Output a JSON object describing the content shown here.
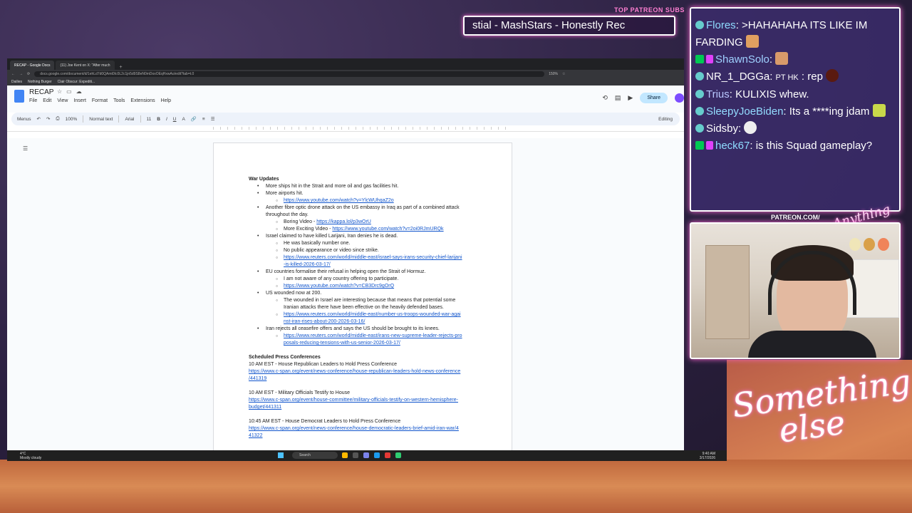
{
  "overlay": {
    "patreon_subs_label": "TOP PATREON SUBS",
    "ticker_text": "stial - MashStars - Honestly Rec",
    "patreon_url": "PATREON.COM/",
    "brand_small": "Anything Else",
    "brand_large_line1": "Something",
    "brand_large_line2": "else"
  },
  "browser": {
    "tabs": [
      {
        "label": "RECAP - Google Docs",
        "active": true
      },
      {
        "label": "(11) Joe Kent on X: \"After much",
        "active": false
      }
    ],
    "new_tab": "+",
    "url": "docs.google.com/document/d/1ehLd7d0QAmt0Ic0L2c1jn5d9S8eN0mDoxOEqHxwAo/edit?tab=t.0",
    "zoom_badge": "150%",
    "bookmarks": [
      "Dailies",
      "Nothing Burger",
      "Clair Obscur: Expediti..."
    ]
  },
  "docs": {
    "title": "RECAP",
    "menu": [
      "File",
      "Edit",
      "View",
      "Insert",
      "Format",
      "Tools",
      "Extensions",
      "Help"
    ],
    "share_label": "Share",
    "toolbar": {
      "menus": "Menus",
      "zoom": "100%",
      "style": "Normal text",
      "font": "Arial",
      "size": "11",
      "editing": "Editing"
    }
  },
  "document": {
    "heading1": "War Updates",
    "b1_ships": "More ships hit in the Strait and more oil and gas facilities hit.",
    "b1_airports": "More airports hit.",
    "l_airports": "https://www.youtube.com/watch?v=YlcWUhqaZ2o",
    "b1_drone1": "Another fibre optic drone attack on the US embassy in Iraq as part of a combined attack",
    "b1_drone2": "throughout the day.",
    "b2_boring_label": "Boring Video - ",
    "l_boring": "https://kappa.lol/p3wOrU",
    "b2_exciting_label": "More Exciting Video - ",
    "l_exciting": "https://www.youtube.com/watch?v=2oi0RJmURQk",
    "b1_larijani": "Israel claimed to have killed Larijani, Iran denies he is dead.",
    "b2_number1": "He was basically number one.",
    "b2_noappear": "No public appearance or video since strike.",
    "l_larijani1": "https://www.reuters.com/world/middle-east/israel-says-irans-security-chief-larijani",
    "l_larijani2": "-is-killed-2026-03-17/",
    "b1_eu": "EU countries formalise their refusal in helping open the Strait of Hormuz.",
    "b2_unaware": "I am not aware of any country offering to participate.",
    "l_eu": "https://www.youtube.com/watch?v=CB3Drc9gOrQ",
    "b1_wounded": "US wounded now at 200.",
    "b2_wounded1": "The wounded in Israel are interesting because that means that potential some",
    "b2_wounded2": "Iranian attacks there have been effective on the heavily defended bases.",
    "l_wounded1": "https://www.reuters.com/world/middle-east/number-us-troops-wounded-war-agai",
    "l_wounded2": "nst-iran-rises-about-200-2026-03-16/",
    "b1_ceasefire": "Iran rejects all ceasefire offers and says the US should be brought to its knees.",
    "l_ceasefire1": "https://www.reuters.com/world/middle-east/irans-new-supreme-leader-rejects-pro",
    "l_ceasefire2": "posals-reducing-tensions-with-us-senior-2026-03-17/",
    "heading2": "Scheduled Press Conferences",
    "pc1": "10 AM EST - House Republican Leaders to Hold Press Conference",
    "pc1_l1": "https://www.c-span.org/event/news-conference/house-republican-leaders-hold-news-conference",
    "pc1_l2": "/441319",
    "pc2": "10 AM EST - Military Officials Testify to House",
    "pc2_l1": "https://www.c-span.org/event/house-committee/military-officials-testify-on-western-hemisphere-",
    "pc2_l2": "budget/441311",
    "pc3": "10:45 AM EST - House Democrat Leaders to Hold Press Conference",
    "pc3_l1": "https://www.c-span.org/event/news-conference/house-democratic-leaders-brief-amid-iran-war/4",
    "pc3_l2": "41322"
  },
  "taskbar": {
    "weather_temp": "4°C",
    "weather_desc": "Mostly cloudy",
    "search": "Search",
    "time": "9:40 AM",
    "date": "3/17/2026"
  },
  "chat": {
    "messages": [
      {
        "user": "Flores",
        "text": ">HAHAHAHA ITS LIKE IM FARDING"
      },
      {
        "user": "ShawnSolo",
        "text": ""
      },
      {
        "user": "NR_1_DGGa",
        "text": "rep",
        "tag": "PT HK"
      },
      {
        "user": "Trius",
        "text": "KULIXIS whew."
      },
      {
        "user": "SleepyJoeBiden",
        "text": "Its a ****ing jdam"
      },
      {
        "user": "Sidsby",
        "text": ""
      },
      {
        "user": "heck67",
        "text": "is this Squad gameplay?"
      }
    ]
  },
  "colors": {
    "accent_pink": "#ff6ad5",
    "chat_bg": "#3c2d6e",
    "docs_blue": "#4285f4",
    "link": "#1155cc"
  }
}
